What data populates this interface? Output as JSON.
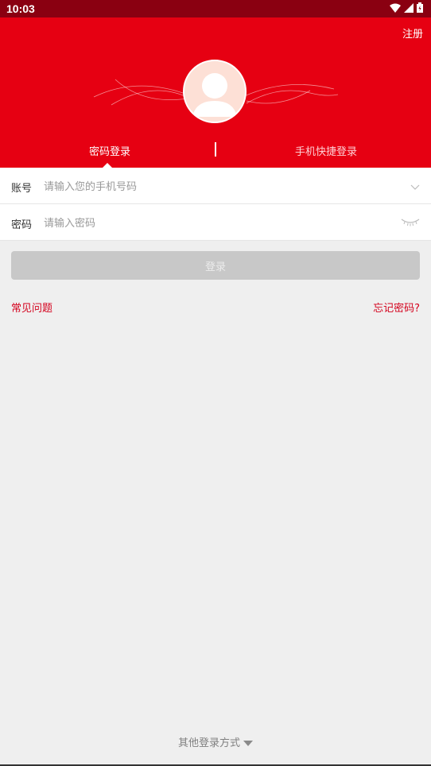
{
  "status_bar": {
    "time": "10:03"
  },
  "header": {
    "register_label": "注册",
    "tabs": [
      {
        "label": "密码登录",
        "active": true
      },
      {
        "label": "手机快捷登录",
        "active": false
      }
    ]
  },
  "form": {
    "account": {
      "label": "账号",
      "placeholder": "请输入您的手机号码",
      "value": ""
    },
    "password": {
      "label": "密码",
      "placeholder": "请输入密码",
      "value": ""
    }
  },
  "login_button": "登录",
  "links": {
    "faq": "常见问题",
    "forgot": "忘记密码?"
  },
  "other_login": "其他登录方式",
  "colors": {
    "brand": "#e60012",
    "link": "#d4021d",
    "button_disabled": "#c8c8c8"
  }
}
